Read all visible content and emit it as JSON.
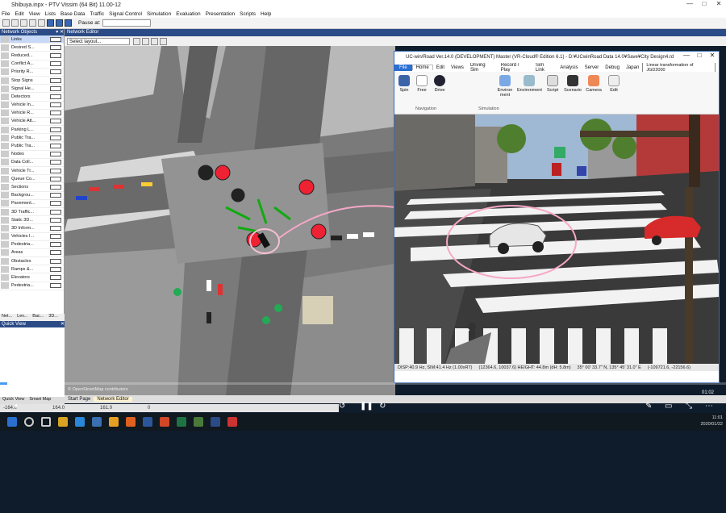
{
  "window": {
    "title": "Shibuya.inpx - PTV Vissim (64 Bit) 11.00-12",
    "controls": [
      "—",
      "□",
      "✕"
    ]
  },
  "menu": [
    "File",
    "Edit",
    "View",
    "Lists",
    "Base Data",
    "Traffic",
    "Signal Control",
    "Simulation",
    "Evaluation",
    "Presentation",
    "Scripts",
    "Help"
  ],
  "toolbar": {
    "pause_label": "Pause at:"
  },
  "network_objects": {
    "title": "Network Objects",
    "items": [
      "Links",
      "Desired S...",
      "Reduced...",
      "Conflict A...",
      "Priority R...",
      "Stop Signs",
      "Signal He...",
      "Detectors",
      "Vehicle In...",
      "Vehicle R...",
      "Vehicle Att...",
      "Parking L...",
      "Public Tra...",
      "Public Tra...",
      "Nodes",
      "Data Coll...",
      "Vehicle Tr...",
      "Queue Co...",
      "Sections",
      "Backgrou...",
      "Pavement...",
      "3D Traffic...",
      "Static 3D...",
      "3D Inform...",
      "Vehicles I...",
      "Pedestria...",
      "Areas",
      "Obstacles",
      "Ramps &...",
      "Elevators",
      "Pedestria..."
    ],
    "tabs": [
      "Net...",
      "Lev...",
      "Bac...",
      "3D..."
    ]
  },
  "quick_view": {
    "title": "Quick View",
    "tabs": [
      "Quick View",
      "Smart Map"
    ]
  },
  "network_editor": {
    "title": "Network Editor",
    "layout_select": "Select layout...",
    "attribution": "© OpenStreetMap contributors",
    "page_tabs": [
      "Start Page",
      "Network Editor"
    ]
  },
  "status_bar": {
    "values": [
      "-164.0",
      "164.0",
      "161.0",
      "0"
    ]
  },
  "video": {
    "current": "00:21",
    "end": "01:02",
    "progress": 0.01
  },
  "ucwin": {
    "title": "UC-win/Road Ver.14.0 (DEVELOPMENT) Master (VR-Cloud® Edition 6.1) - D:¥UCwinRoad Data 14.0¥Save¥City Design4.rd",
    "controls": [
      "—",
      "□",
      "✕"
    ],
    "menu": [
      "File",
      "Home",
      "Edit",
      "Views",
      "Driving Sim",
      "Record / Play",
      "Sim Link",
      "Analysis",
      "Server",
      "Debug",
      "Japan"
    ],
    "projection": "Linear transformation of JGD2000",
    "ribbon_buttons": [
      "Spin",
      "Free",
      "Drive",
      "Environ ment",
      "Environment",
      "Script",
      "Scenario",
      "Camera",
      "Edit"
    ],
    "ribbon_groups": [
      "Navigation",
      "Simulation"
    ],
    "status": [
      "DISP:40.9 Hz, SIM:41.4 Hz (1.00xRT)",
      "(12364.6, 10037.6) HEIGHT: 44.8m (dH: 5.8m)",
      "35° 00' 33.7\" N, 135° 45' 31.0\" E",
      "(-109721.6, -22156.6)"
    ]
  },
  "taskbar": {
    "time": "11:01",
    "date": "2020/01/22"
  }
}
